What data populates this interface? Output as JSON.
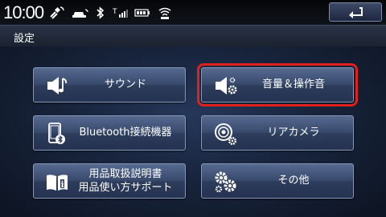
{
  "status": {
    "time": "10:00",
    "icons": [
      "gps-satellite-icon",
      "car-connection-icon",
      "bluetooth-icon",
      "signal-strength-icon",
      "battery-icon",
      "vics-icon"
    ],
    "back_icon": "return-arrow-icon"
  },
  "header": {
    "title": "設定"
  },
  "menu": {
    "sound": {
      "label": "サウンド",
      "icon": "speaker-note-icon"
    },
    "volume": {
      "label": "音量＆操作音",
      "icon": "speaker-gear-icon",
      "selected": true
    },
    "bluetooth": {
      "label": "Bluetooth接続機器",
      "icon": "phone-bluetooth-icon"
    },
    "rear_camera": {
      "label": "リアカメラ",
      "icon": "camera-gear-icon"
    },
    "manual": {
      "line1": "用品取扱説明書",
      "line2": "用品使い方サポート",
      "icon": "book-info-icon"
    },
    "other": {
      "label": "その他",
      "icon": "gears-icon"
    }
  },
  "colors": {
    "selection": "#e0201c",
    "button": "#384a6c",
    "background": "#0b0f17"
  }
}
